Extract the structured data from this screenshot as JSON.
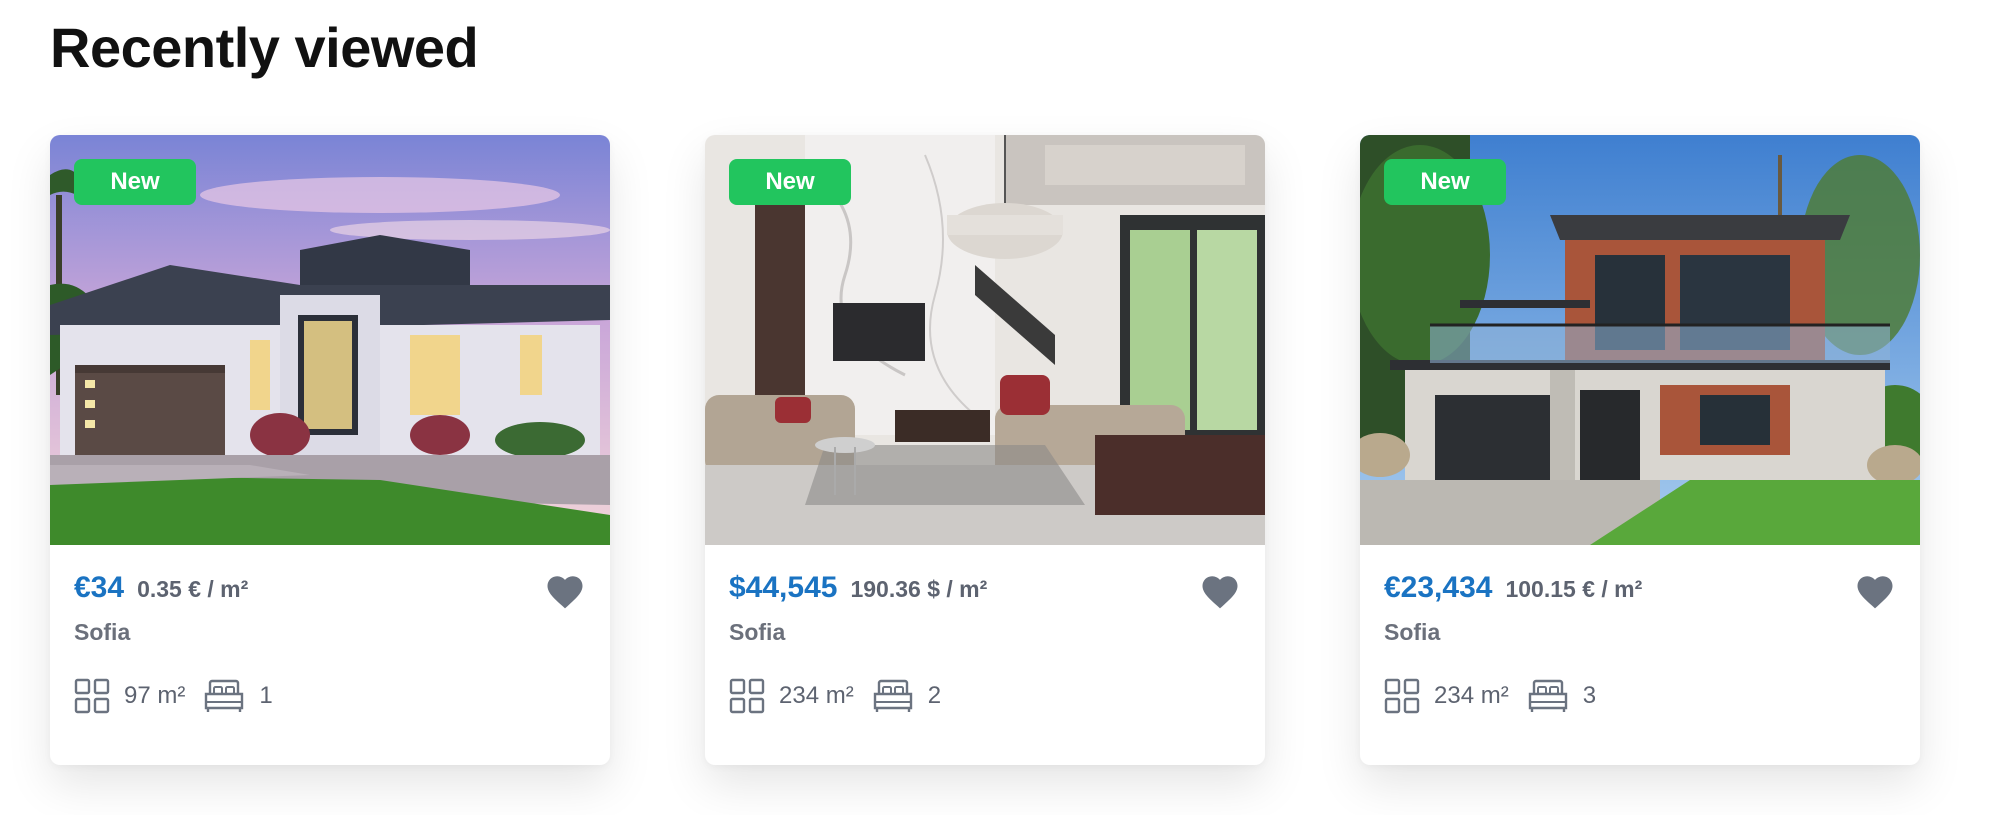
{
  "section": {
    "title": "Recently viewed"
  },
  "icons": {
    "area": "grid-squares-icon",
    "bed": "bed-icon",
    "favorite": "heart-icon"
  },
  "colors": {
    "badge": "#22c55e",
    "price": "#1a73c2",
    "heart": "#6b7380"
  },
  "listings": [
    {
      "badge": "New",
      "price": "€34",
      "price_per_m2": "0.35 € / m²",
      "city": "Sofia",
      "area": "97 m²",
      "rooms": "1",
      "photo": "exterior-dusk-bungalow"
    },
    {
      "badge": "New",
      "price": "$44,545",
      "price_per_m2": "190.36 $ / m²",
      "city": "Sofia",
      "area": "234 m²",
      "rooms": "2",
      "photo": "interior-living-room"
    },
    {
      "badge": "New",
      "price": "€23,434",
      "price_per_m2": "100.15 € / m²",
      "city": "Sofia",
      "area": "234 m²",
      "rooms": "3",
      "photo": "modern-house-exterior"
    }
  ]
}
